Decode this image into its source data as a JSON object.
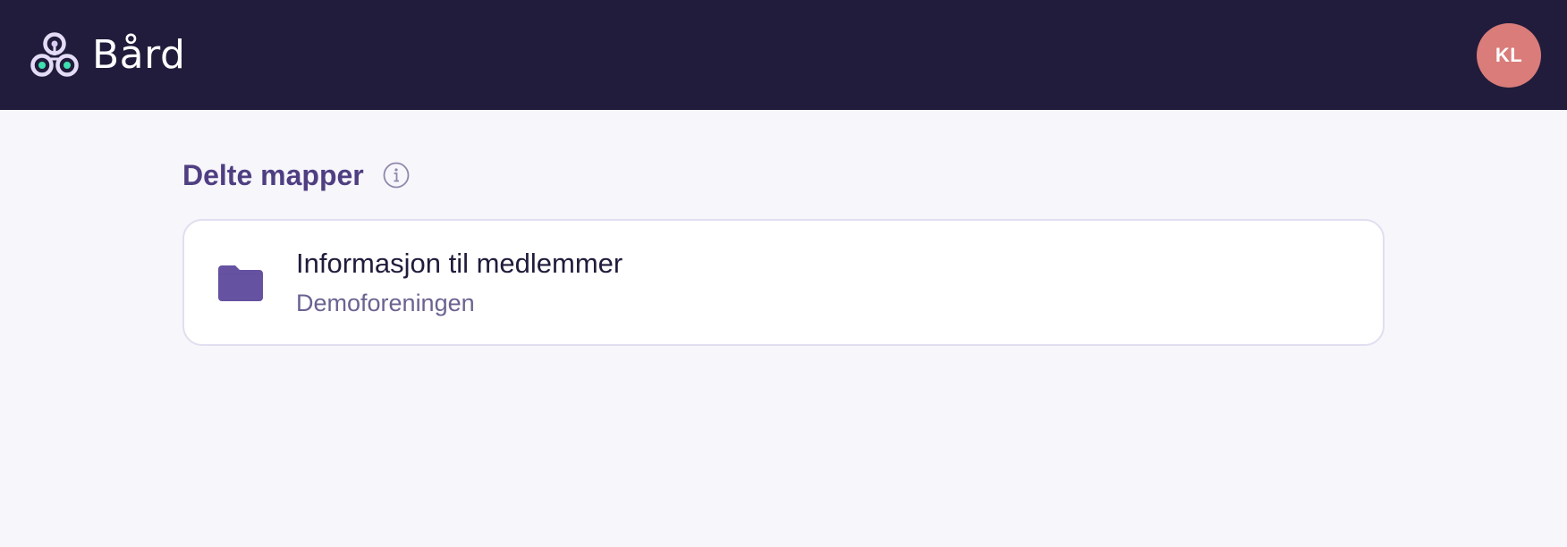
{
  "header": {
    "brand_name": "Bård",
    "logo_icon": "network-logo-icon",
    "avatar_initials": "KL"
  },
  "shared_folders": {
    "title": "Delte mapper",
    "info_icon": "info-icon",
    "folders": [
      {
        "name": "Informasjon til medlemmer",
        "organization": "Demoforeningen",
        "icon": "folder-icon"
      }
    ]
  },
  "colors": {
    "header_bg": "#211c3b",
    "page_bg": "#f7f6fb",
    "accent": "#4f3f82",
    "folder_icon": "#6552a0",
    "avatar_bg": "#d97c7a",
    "logo_dot": "#3ee0b0"
  }
}
